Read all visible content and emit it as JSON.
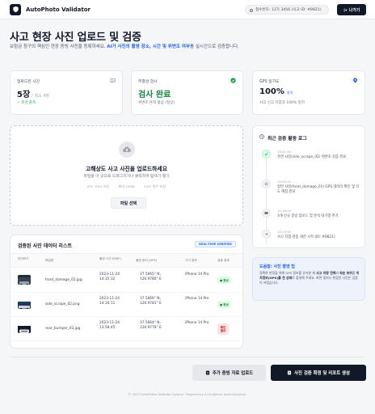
{
  "header": {
    "app_title": "AutoPhoto Validator",
    "user_chip": "접수번호: 12가 3456 (사고 ID: #8821)",
    "logout_label": "나가기"
  },
  "page": {
    "title": "사고 현장 사진 업로드 및 검증",
    "desc_before": "보험금 청구의 핵심인 현장 증빙 사진을 등록하세요. ",
    "desc_highlight": "AI가 사진의 촬영 장소, 시간 및 위변조 여부",
    "desc_after": "를 실시간으로 검증합니다."
  },
  "stats": [
    {
      "label": "업로드된 사진",
      "value": "5장",
      "value_suffix": "/ 최소 4장",
      "sub": "✓ 조건 충족",
      "icon": "image-icon"
    },
    {
      "label": "무결성 검사",
      "value": "검사 완료",
      "value_suffix": "",
      "sub": "위변조 흔적 없음 (정상)",
      "icon": "check-circle-icon"
    },
    {
      "label": "GPS 일치도",
      "value": "100%",
      "value_suffix": "",
      "tag": "일치",
      "sub": "사고 신고 지점과 100% 일치",
      "icon": "pin-icon"
    }
  ],
  "upload": {
    "title": "고해상도 사고 사진을 업로드하세요",
    "subtitle": "파일을 이 곳으로 드래그하거나 클릭하여 탐색기 열기",
    "meta": [
      "JPG, PNG 지원",
      "최대 20MB",
      "EXIF 필수 포함"
    ],
    "button_label": "파일 선택"
  },
  "list": {
    "title": "검증된 사진 데이터 리스트",
    "badge": "REAL-TIME VERIFIED",
    "columns": [
      "미리보기",
      "파일명",
      "촬영 시간 (EXIF)",
      "촬영 위치 (GPS)",
      "기기 정보",
      "검증 결과"
    ],
    "rows": [
      {
        "file": "front_damage_01.jpg",
        "time": "2023-11-24 14:15:32",
        "gps": "37.5665° N, 126.9780° E",
        "device": "iPhone 14 Pro",
        "status": "정상"
      },
      {
        "file": "side_scrape_02.png",
        "time": "2023-11-24 14:16:11",
        "gps": "37.5666° N, 126.9781° E",
        "device": "iPhone 14 Pro",
        "status": "정상"
      },
      {
        "file": "rear_bumper_03.jpg",
        "time": "2023-11-24 13:58:45",
        "gps": "37.5664° N, 126.9779° E",
        "device": "iPhone 14 Pro",
        "status": "확인 필요"
      }
    ]
  },
  "log": {
    "title": "최근 검증 활동 로그",
    "items": [
      {
        "time": "14:21:45",
        "text": "측면 사진(side_scrape_02) 위변조 검증 완료",
        "done": true
      },
      {
        "time": "14:20:12",
        "text": "정면 사진(front_damage_01) GPS 데이터 확인 및 지도 매칭 완료",
        "done": false
      },
      {
        "time": "14:18:05",
        "text": "3개 신규 증빙 업로드 및 분석 대기열 추가",
        "done": false
      },
      {
        "time": "14:15:00",
        "text": "사고 지점 검증 세션 시작 (ID: #8821)",
        "done": false
      }
    ]
  },
  "help": {
    "title": "도움말: 사진 촬영 팁",
    "body_1": "정확한 판정을 위해 GPS 정보를 유지한 채 ",
    "body_bold_1": "사고 차량 전체",
    "body_2": "와 ",
    "body_bold_2": "파손 부위",
    "body_3": "를 ",
    "body_bold_3": "위치정보(GPS)를 켠 상태",
    "body_4": "로 촬영해 주세요. 화면 캡처나 편집된 사진은 검증이 어렵습니다."
  },
  "footer": {
    "secondary_label": "추가 증빙 자료 업로드",
    "primary_label": "사진 검증 확정 및 리포트 생성",
    "copyright": "© 2023 AutoPhoto Validator System. Powered by AI Evidence Authentication."
  },
  "colors": {
    "accent": "#2563eb",
    "success": "#16a34a",
    "danger": "#b91c1c",
    "dark": "#111827"
  }
}
